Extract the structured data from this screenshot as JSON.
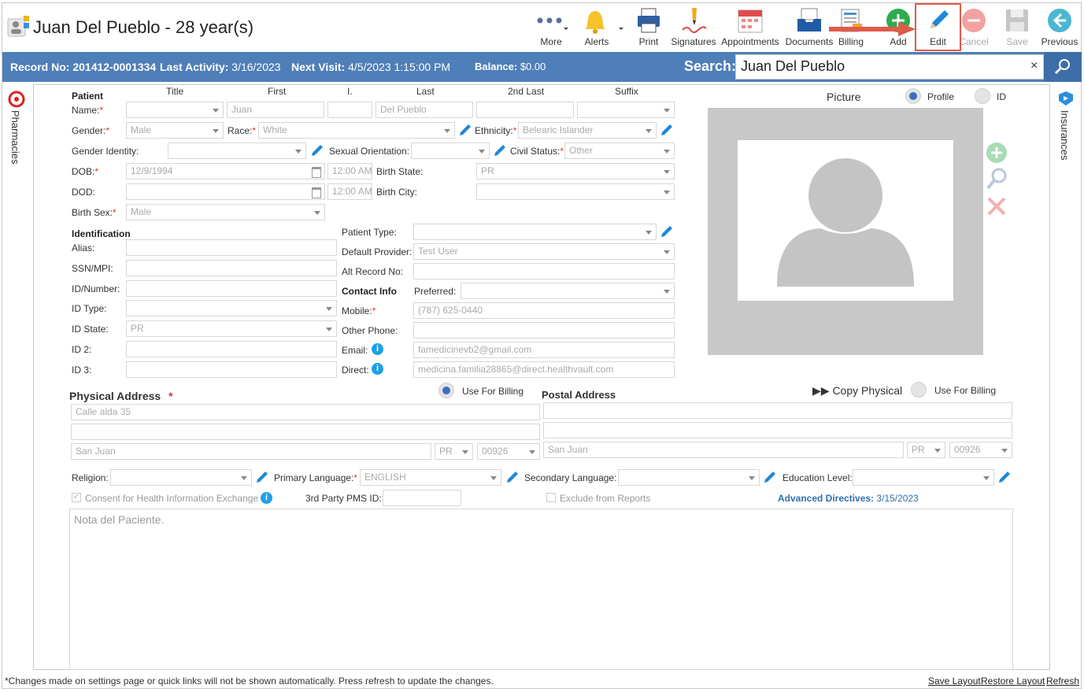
{
  "header": {
    "title": "Juan Del Pueblo - 28 year(s)"
  },
  "toolbar": {
    "more": "More",
    "alerts": "Alerts",
    "print": "Print",
    "signatures": "Signatures",
    "appointments": "Appointments",
    "documents": "Documents",
    "billing": "Billing",
    "add": "Add",
    "edit": "Edit",
    "cancel": "Cancel",
    "save": "Save",
    "previous": "Previous"
  },
  "infobar": {
    "record_label": "Record No:",
    "record_value": "201412-0001334",
    "activity_label": "Last Activity:",
    "activity_value": "3/16/2023",
    "visit_label": "Next Visit:",
    "visit_value": "4/5/2023 1:15:00 PM",
    "balance_label": "Balance:",
    "balance_value": "$0.00",
    "search_label": "Search:",
    "search_value": "Juan Del Pueblo",
    "clear": "×"
  },
  "side": {
    "left": "Pharmacies",
    "right": "Insurances"
  },
  "patient": {
    "section": "Patient",
    "cols": {
      "title": "Title",
      "first": "First",
      "initial": "I.",
      "last": "Last",
      "second_last": "2nd Last",
      "suffix": "Suffix"
    },
    "name_label": "Name:",
    "first_value": "Juan",
    "last_value": "Del Pueblo",
    "gender_label": "Gender:",
    "gender_value": "Male",
    "race_label": "Race:",
    "race_value": "White",
    "ethnicity_label": "Ethnicity:",
    "ethnicity_value": "Belearic Islander",
    "gender_identity_label": "Gender Identity:",
    "sexual_orientation_label": "Sexual Orientation:",
    "civil_status_label": "Civil Status:",
    "civil_status_value": "Other",
    "dob_label": "DOB:",
    "dob_value": "12/9/1994",
    "dob_time": "12:00 AM",
    "birth_state_label": "Birth State:",
    "birth_state_value": "PR",
    "dod_label": "DOD:",
    "dod_time": "12:00 AM",
    "birth_city_label": "Birth City:",
    "birth_sex_label": "Birth Sex:",
    "birth_sex_value": "Male"
  },
  "identification": {
    "section": "Identification",
    "alias_label": "Alias:",
    "ssn_label": "SSN/MPI:",
    "idnum_label": "ID/Number:",
    "idtype_label": "ID Type:",
    "idstate_label": "ID State:",
    "idstate_value": "PR",
    "id2_label": "ID 2:",
    "id3_label": "ID 3:",
    "patient_type_label": "Patient Type:",
    "default_provider_label": "Default Provider:",
    "default_provider_value": "Test User",
    "alt_record_label": "Alt Record No:"
  },
  "contact": {
    "section": "Contact Info",
    "preferred_label": "Preferred:",
    "mobile_label": "Mobile:",
    "mobile_value": "(787) 625-0440",
    "other_phone_label": "Other Phone:",
    "email_label": "Email:",
    "email_value": "famedicinevb2@gmail.com",
    "direct_label": "Direct:",
    "direct_value": "medicina.familia28865@direct.healthvault.com",
    "info": "i"
  },
  "picture": {
    "label": "Picture",
    "profile": "Profile",
    "id": "ID"
  },
  "physical": {
    "section": "Physical Address",
    "required": "*",
    "use_billing": "Use For Billing",
    "line1": "Calle alda 35",
    "city": "San Juan",
    "state": "PR",
    "zip": "00926"
  },
  "postal": {
    "section": "Postal Address",
    "copy": "Copy Physical",
    "use_billing": "Use For Billing",
    "city": "San Juan",
    "state": "PR",
    "zip": "00926"
  },
  "misc": {
    "religion_label": "Religion:",
    "primary_language_label": "Primary Language:",
    "primary_language_value": "ENGLISH",
    "secondary_language_label": "Secondary Language:",
    "education_label": "Education Level:",
    "consent_label": "Consent for Health Information Exchange",
    "pms_label": "3rd Party PMS ID:",
    "exclude_label": "Exclude from Reports",
    "directives_label": "Advanced Directives:",
    "directives_value": "3/15/2023",
    "notes_placeholder": "Nota del Paciente."
  },
  "footer": {
    "note": "*Changes made on settings page or quick links will not be shown automatically. Press refresh to update the changes.",
    "save_layout": "Save Layout",
    "restore_layout": "Restore Layout",
    "refresh": "Refresh"
  },
  "colors": {
    "bar": "#4f7fb8",
    "accent": "#1ea0e6",
    "highlight": "#e05a4a"
  }
}
